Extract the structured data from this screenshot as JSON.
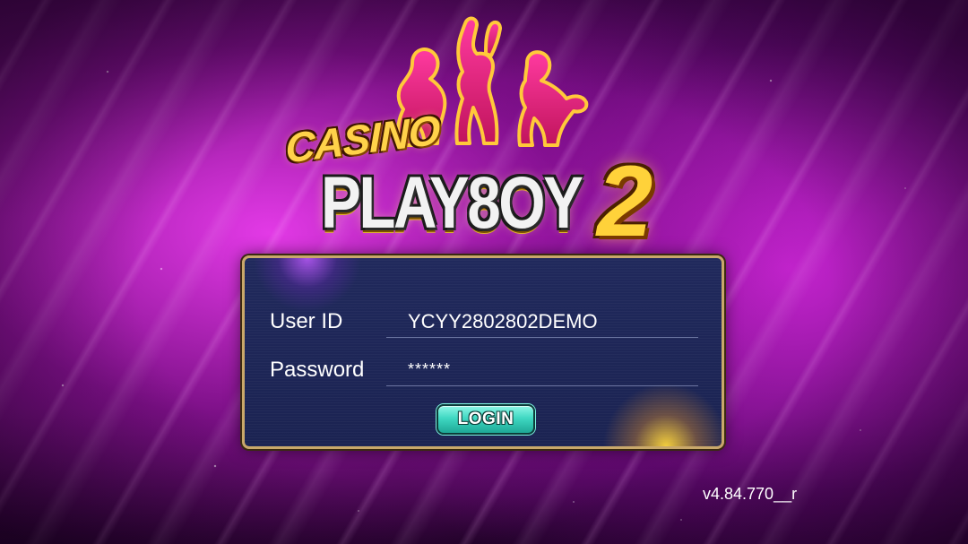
{
  "logo": {
    "casino_text": "CASINO",
    "main_text": "PLAY8OY",
    "number_text": "2"
  },
  "login": {
    "userid_label": "User ID",
    "userid_value": "YCYY2802802DEMO",
    "password_label": "Password",
    "password_value": "******",
    "login_button_label": "LOGIN"
  },
  "footer": {
    "version": "v4.84.770__r"
  },
  "colors": {
    "background_magenta": "#b41fc0",
    "panel_navy": "#1f2858",
    "panel_border_gold": "#c9a86a",
    "button_teal": "#3fd8c2",
    "logo_gold": "#ffd24a",
    "logo_pink": "#e0287a"
  }
}
